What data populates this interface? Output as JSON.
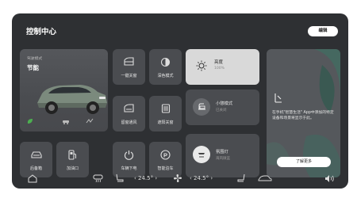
{
  "header": {
    "title": "控制中心",
    "edit_label": "编辑"
  },
  "mode_card": {
    "small_label": "驾驶模式",
    "mode_name": "节能"
  },
  "tiles": [
    {
      "id": "lock",
      "label": "一键关窗"
    },
    {
      "id": "dark",
      "label": "深色模式"
    },
    {
      "id": "vent",
      "label": "留窗通风"
    },
    {
      "id": "sunshade",
      "label": "遮阳关窗"
    },
    {
      "id": "trunk",
      "label": "后备箱"
    },
    {
      "id": "fuel",
      "label": "加油口"
    },
    {
      "id": "power",
      "label": "车辆下电"
    },
    {
      "id": "park",
      "label": "智能泊车"
    }
  ],
  "brightness": {
    "title": "亮度",
    "value": "100%"
  },
  "nap": {
    "title": "小憩模式",
    "status": "已关闭"
  },
  "ambient": {
    "title": "氛围灯",
    "status": "海风微蓝"
  },
  "info_card": {
    "description": "在手机\"智慧生活\" App中添加的特定设备和场景将显示于此。",
    "button_label": "了解更多"
  },
  "bottom_bar": {
    "left_temp": "‹ 24.5° ›",
    "right_temp": "‹ 24.5° ›"
  },
  "colors": {
    "background": "#2e3033",
    "tile": "#4a4c50",
    "accent_green": "#4caf50"
  }
}
